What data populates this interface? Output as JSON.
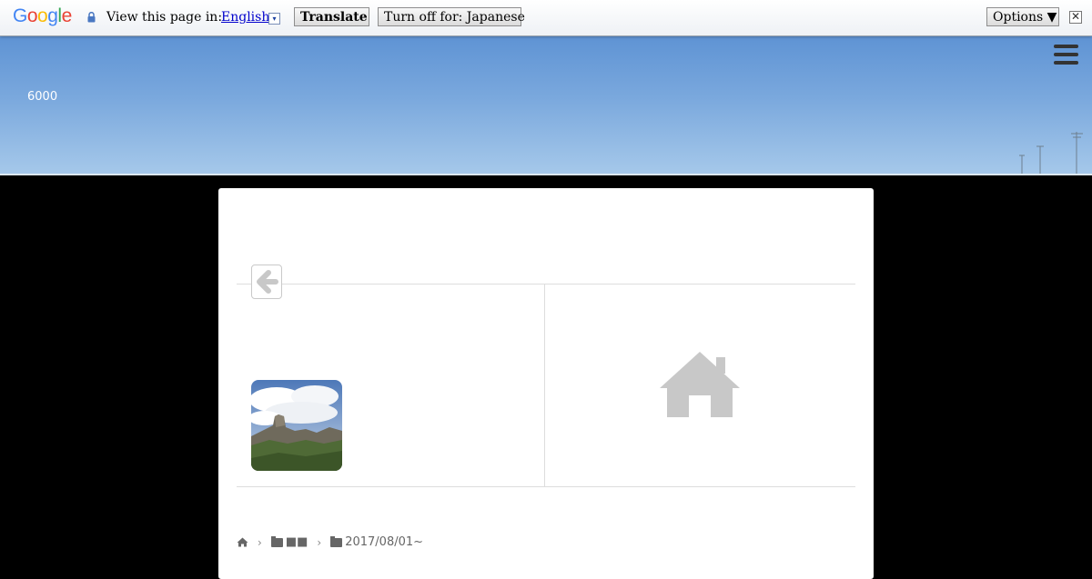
{
  "translate_bar": {
    "logo_text": [
      "G",
      "o",
      "o",
      "g",
      "l",
      "e"
    ],
    "label": "View this page in:",
    "language": "English",
    "dropdown_arrow": "▾",
    "translate_button": "Translate",
    "turn_off_button": "Turn off for: Japanese",
    "options_button": "Options ▼",
    "close_glyph": "✕",
    "icons": {
      "lock": "lock-icon",
      "close": "close-icon"
    }
  },
  "header": {
    "site_number": "6000",
    "menu_icon": "hamburger-menu-icon"
  },
  "post_nav": {
    "back_icon": "arrow-left-icon",
    "next_placeholder_icon": "home-icon"
  },
  "breadcrumb": {
    "home_icon": "home-icon",
    "separator": "›",
    "items": [
      {
        "icon": "folder-icon",
        "label": "■■"
      },
      {
        "icon": "folder-icon",
        "label": "2017/08/01~"
      }
    ]
  },
  "colors": {
    "sky_top": "#5e93d4",
    "sky_bottom": "#a5c8ea",
    "page_background": "#000000",
    "card_background": "#ffffff",
    "icon_gray": "#c8c8c8"
  }
}
